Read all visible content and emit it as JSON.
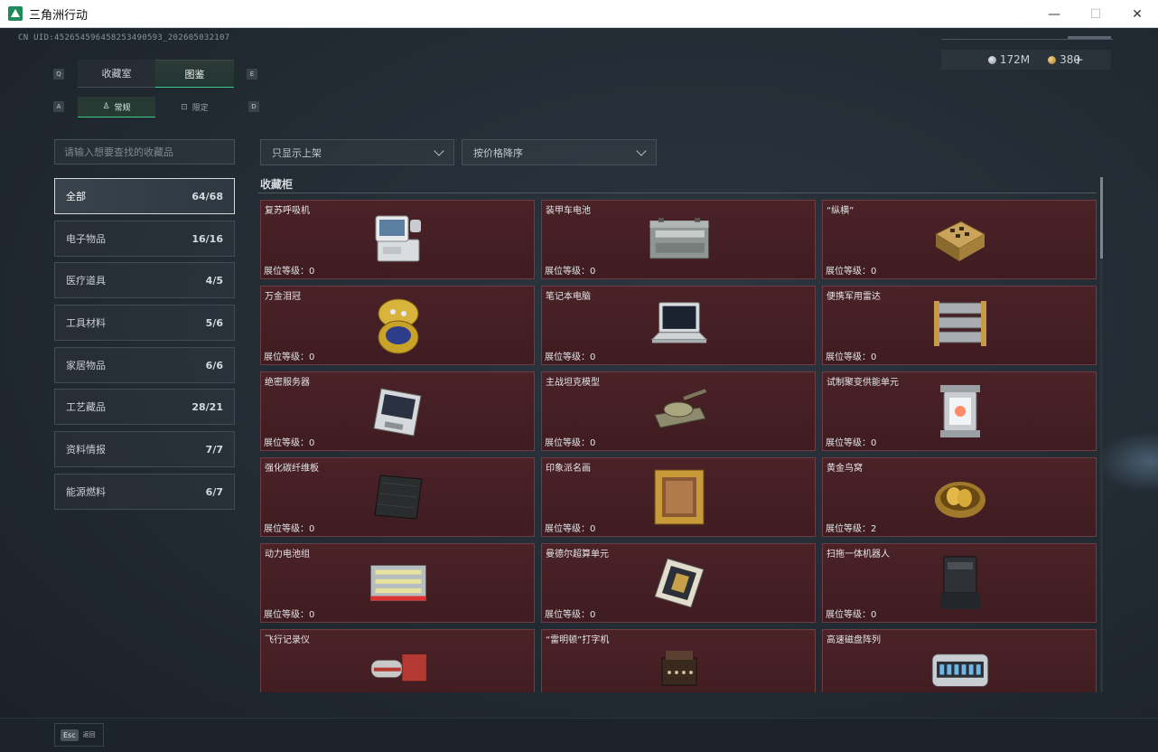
{
  "window": {
    "title": "三角洲行动",
    "minimize": "—",
    "maximize": "☐",
    "close": "✕"
  },
  "uid": "CN UID:452654596458253490593_202605032107",
  "currency": {
    "silver": "172M",
    "gold": "380",
    "plus": "+"
  },
  "tabs": {
    "key_left": "Q",
    "key_right": "E",
    "items": [
      {
        "label": "收藏室"
      },
      {
        "label": "图鉴"
      }
    ]
  },
  "subtabs": {
    "key_left": "A",
    "key_right": "D",
    "items": [
      {
        "label": "常规"
      },
      {
        "label": "限定"
      }
    ]
  },
  "search": {
    "placeholder": "请输入想要查找的收藏品"
  },
  "filters": {
    "shelf": "只显示上架",
    "sort": "按价格降序"
  },
  "categories": [
    {
      "label": "全部",
      "count": "64/68"
    },
    {
      "label": "电子物品",
      "count": "16/16"
    },
    {
      "label": "医疗道具",
      "count": "4/5"
    },
    {
      "label": "工具材料",
      "count": "5/6"
    },
    {
      "label": "家居物品",
      "count": "6/6"
    },
    {
      "label": "工艺藏品",
      "count": "28/21"
    },
    {
      "label": "资料情报",
      "count": "7/7"
    },
    {
      "label": "能源燃料",
      "count": "6/7"
    }
  ],
  "section_title": "收藏柜",
  "level_label": "展位等级：",
  "items": [
    {
      "name": "复苏呼吸机",
      "level": "0",
      "icon": "ventilator-icon"
    },
    {
      "name": "装甲车电池",
      "level": "0",
      "icon": "battery-icon"
    },
    {
      "name": "“纵横”",
      "level": "0",
      "icon": "chessboard-icon"
    },
    {
      "name": "万金泪冠",
      "level": "0",
      "icon": "jeweled-egg-icon"
    },
    {
      "name": "笔记本电脑",
      "level": "0",
      "icon": "laptop-icon"
    },
    {
      "name": "便携军用雷达",
      "level": "0",
      "icon": "radar-icon"
    },
    {
      "name": "绝密服务器",
      "level": "0",
      "icon": "server-icon"
    },
    {
      "name": "主战坦克模型",
      "level": "0",
      "icon": "tank-icon"
    },
    {
      "name": "试制聚变供能单元",
      "level": "0",
      "icon": "fusion-cell-icon"
    },
    {
      "name": "强化碳纤维板",
      "level": "0",
      "icon": "carbon-plate-icon"
    },
    {
      "name": "印象派名画",
      "level": "0",
      "icon": "painting-icon"
    },
    {
      "name": "黄金鸟窝",
      "level": "2",
      "icon": "golden-nest-icon"
    },
    {
      "name": "动力电池组",
      "level": "0",
      "icon": "battery-pack-icon"
    },
    {
      "name": "曼德尔超算单元",
      "level": "0",
      "icon": "compute-unit-icon"
    },
    {
      "name": "扫拖一体机器人",
      "level": "0",
      "icon": "mop-robot-icon"
    },
    {
      "name": "飞行记录仪",
      "level": "",
      "icon": "flight-recorder-icon"
    },
    {
      "name": "“雷明顿”打字机",
      "level": "",
      "icon": "typewriter-icon"
    },
    {
      "name": "高速磁盘阵列",
      "level": "",
      "icon": "disk-array-icon"
    }
  ],
  "footer": {
    "esc_key": "Esc",
    "esc_label": "返回"
  }
}
